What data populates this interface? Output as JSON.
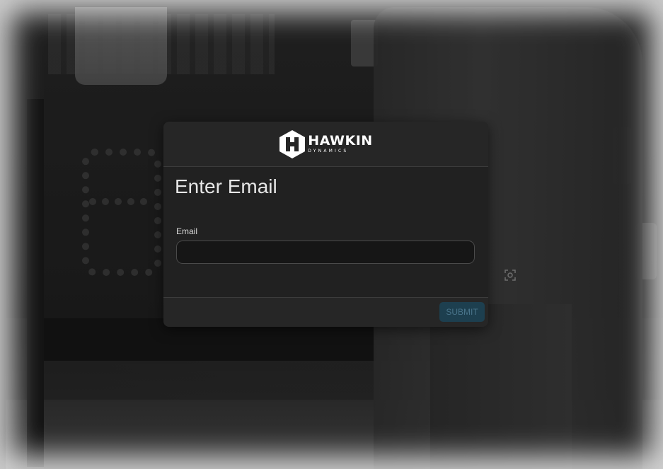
{
  "brand": {
    "name": "HAWKIN",
    "tagline": "DYNAMICS"
  },
  "modal": {
    "title": "Enter Email",
    "email_label": "Email",
    "email_value": "",
    "email_placeholder": "",
    "submit_label": "SUBMIT"
  },
  "colors": {
    "modal_bg": "#212121",
    "submit_bg": "#1d3f4f",
    "submit_text": "#49748a"
  },
  "icons": {
    "logo": "hawkin-hexagon-logo",
    "background_icon": "focus-scan-icon"
  }
}
